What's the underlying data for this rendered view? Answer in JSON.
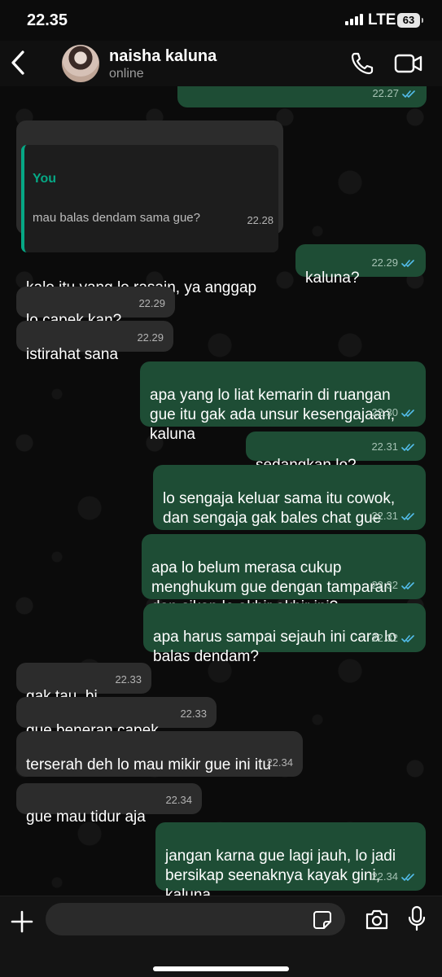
{
  "status_bar": {
    "time": "22.35",
    "network": "LTE",
    "battery": "63"
  },
  "header": {
    "contact_name": "naisha kaluna",
    "contact_status": "online"
  },
  "chat": {
    "messages": [
      {
        "dir": "out",
        "text": "",
        "time": "22.27",
        "read": true
      },
      {
        "dir": "in",
        "reply": {
          "author": "You",
          "text": "mau balas dendam sama gue?"
        },
        "text": "kalo itu yang lo rasain, ya anggap\naja gitu",
        "time": "22.28"
      },
      {
        "dir": "out",
        "text": "kaluna?",
        "time": "22.29",
        "read": true
      },
      {
        "dir": "in",
        "text": "lo capek kan?",
        "time": "22.29"
      },
      {
        "dir": "in",
        "text": "istirahat sana",
        "time": "22.29"
      },
      {
        "dir": "out",
        "text": "apa yang lo liat kemarin di ruangan\ngue itu gak ada unsur kesengajaan,\nkaluna",
        "time": "22.30",
        "read": true
      },
      {
        "dir": "out",
        "text": "sedangkan lo?",
        "time": "22.31",
        "read": true
      },
      {
        "dir": "out",
        "text": "lo sengaja keluar sama itu cowok,\ndan sengaja gak bales chat gue",
        "time": "22.31",
        "read": true
      },
      {
        "dir": "out",
        "text": "apa lo belum merasa cukup\nmenghukum gue dengan tamparan\ndan sikap lo akhir akhir ini?",
        "time": "22.32",
        "read": true
      },
      {
        "dir": "out",
        "text": "apa harus sampai sejauh ini cara lo\nbalas dendam?",
        "time": "22.32",
        "read": true
      },
      {
        "dir": "in",
        "text": "gak tau, bi",
        "time": "22.33"
      },
      {
        "dir": "in",
        "text": "gue beneran capek",
        "time": "22.33"
      },
      {
        "dir": "in",
        "text": "terserah deh lo mau mikir gue ini itu",
        "time": "22.34"
      },
      {
        "dir": "in",
        "text": "gue mau tidur aja",
        "time": "22.34"
      },
      {
        "dir": "out",
        "text": "jangan karna gue lagi jauh, lo jadi\nbersikap seenaknya kayak gini,\nkaluna.",
        "time": "22.34",
        "read": true
      }
    ]
  },
  "input": {
    "placeholder": ""
  },
  "colors": {
    "outgoing_bubble": "#1e4d35",
    "incoming_bubble": "#2c2c2c",
    "accent": "#06a885",
    "read_ticks": "#53bdeb"
  },
  "icons": [
    "back-icon",
    "call-icon",
    "video-call-icon",
    "plus-icon",
    "sticker-icon",
    "camera-icon",
    "mic-icon",
    "read-receipt-icon"
  ]
}
